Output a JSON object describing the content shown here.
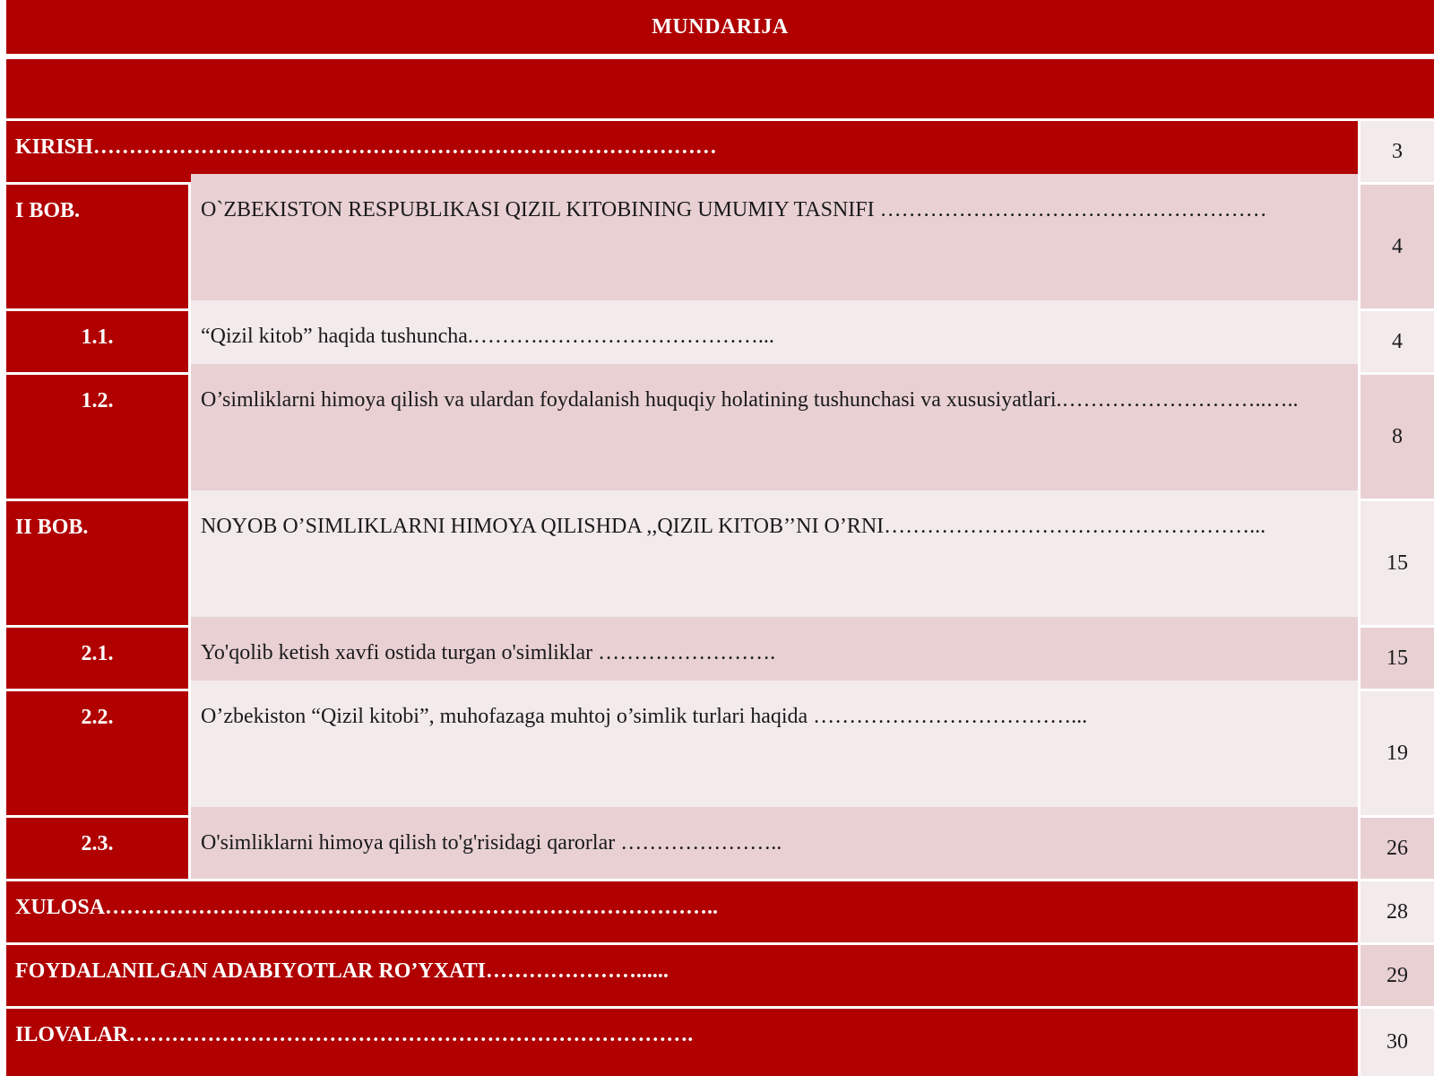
{
  "title": "MUNDARIJA",
  "colors": {
    "accent_red": "#b00000",
    "row_pink": "#e8d0d3",
    "row_light": "#f3eaeb"
  },
  "entries": [
    {
      "label": "KIRISH……………………………………………………………………………",
      "page": "3"
    },
    {
      "code": "I BOB.",
      "text": "O`ZBEKISTON RESPUBLIKASI QIZIL KITOBINING UMUMIY TASNIFI ………………………………………………",
      "page": "4"
    },
    {
      "code": "1.1.",
      "text": "“Qizil kitob”  haqida tushuncha.……….…………………………...",
      "page": "4"
    },
    {
      "code": "1.2.",
      "text": "O’simliklarni himoya qilish va ulardan foydalanish huquqiy holatining tushunchasi va xususiyatlari.………………………..…..",
      "page": "8"
    },
    {
      "code": "II BOB.",
      "text": "NOYOB O’SIMLIKLARNI HIMOYA QILISHDA ,,QIZIL KITOB’’NI O’RNI……………………………………………...",
      "page": "15"
    },
    {
      "code": "2.1.",
      "text": "Yo'qolib ketish xavfi ostida turgan o'simliklar …………………….",
      "page": "15"
    },
    {
      "code": "2.2.",
      "text": "O’zbekiston “Qizil kitobi”, muhofazaga muhtoj o’simlik turlari haqida ………………………………...",
      "page": "19"
    },
    {
      "code": "2.3.",
      "text": "O'simliklarni himoya qilish to'g'risidagi qarorlar …………………..",
      "page": "26"
    },
    {
      "label": "XULOSA…………………………………………………………………………..",
      "page": "28"
    },
    {
      "label": "FOYDALANILGAN ADABIYOTLAR RO’YXATI…………………......",
      "page": "29"
    },
    {
      "label": "ILOVALAR…………………………………………………………………….",
      "page": "30"
    }
  ]
}
